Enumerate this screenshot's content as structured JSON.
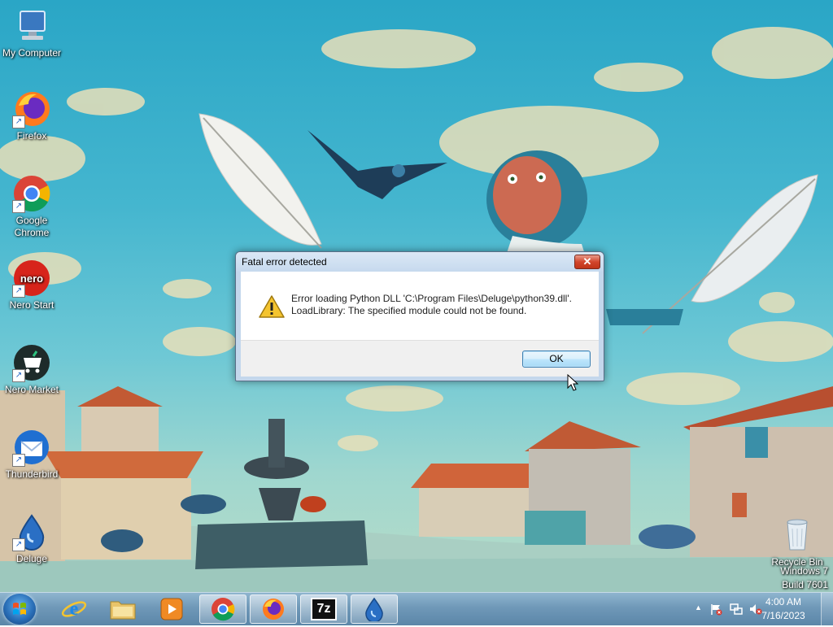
{
  "desktop": {
    "icons": [
      {
        "label": "My Computer",
        "icon": "computer-icon"
      },
      {
        "label": "Firefox",
        "icon": "firefox-icon"
      },
      {
        "label": "Google Chrome",
        "icon": "chrome-icon"
      },
      {
        "label": "Nero Start",
        "icon": "nero-icon"
      },
      {
        "label": "Nero Market",
        "icon": "nero-market-icon"
      },
      {
        "label": "Thunderbird",
        "icon": "thunderbird-icon"
      },
      {
        "label": "Deluge",
        "icon": "deluge-icon"
      }
    ],
    "recycle_bin": {
      "label": "Recycle Bin",
      "icon": "recycle-bin-icon"
    },
    "watermark": {
      "line1": "Windows 7",
      "line2": "Build 7601"
    }
  },
  "dialog": {
    "title": "Fatal error detected",
    "close_glyph": "✕",
    "message_line1": "Error loading Python DLL 'C:\\Program Files\\Deluge\\python39.dll'.",
    "message_line2": "LoadLibrary: The specified module could not be found.",
    "ok_label": "OK",
    "icon": "warning-icon"
  },
  "taskbar": {
    "start": {
      "icon": "windows-start-icon"
    },
    "pinned": [
      {
        "name": "Internet Explorer",
        "icon": "internet-explorer-icon"
      },
      {
        "name": "Windows Explorer",
        "icon": "folder-icon"
      },
      {
        "name": "Windows Media Player",
        "icon": "media-player-icon"
      },
      {
        "name": "Google Chrome",
        "icon": "chrome-icon"
      },
      {
        "name": "Firefox",
        "icon": "firefox-icon"
      },
      {
        "name": "7-Zip",
        "icon": "7zip-icon",
        "text": "7z"
      },
      {
        "name": "Deluge",
        "icon": "deluge-icon"
      }
    ],
    "tray": {
      "overflow_glyph": "▲",
      "icons": [
        "action-center-flag-icon",
        "network-icon",
        "volume-muted-icon"
      ]
    },
    "clock": {
      "time": "4:00 AM",
      "date": "7/16/2023"
    }
  },
  "colors": {
    "sky": "#2aa6c6",
    "taskbar": "#6f98b8",
    "dialog_frame": "#c4d7ec",
    "ok_border": "#3c7fb1",
    "close_red": "#d2462c",
    "warning_yellow": "#f4c430"
  }
}
